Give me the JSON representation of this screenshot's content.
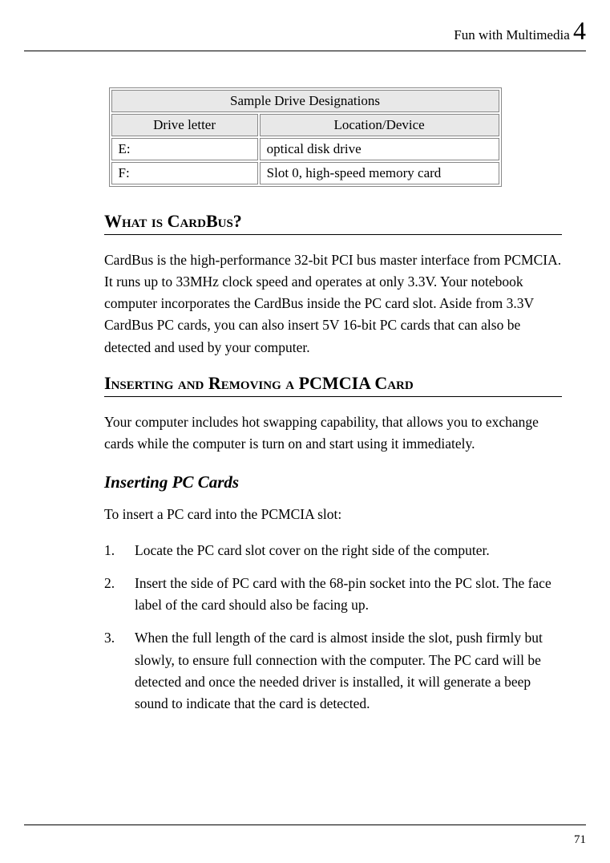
{
  "header": {
    "title": "Fun with Multimedia",
    "chapter": "4"
  },
  "table": {
    "title": "Sample Drive Designations",
    "col1_header": "Drive letter",
    "col2_header": "Location/Device",
    "rows": [
      {
        "letter": "E:",
        "device": "optical disk drive"
      },
      {
        "letter": "F:",
        "device": "Slot 0, high-speed memory card"
      }
    ]
  },
  "section1": {
    "heading": "What is CardBus?",
    "body": "CardBus is the high-performance 32-bit PCI bus master interface from PCMCIA. It runs up to 33MHz clock speed and operates at only 3.3V. Your notebook computer incorporates the CardBus inside the PC card slot. Aside from 3.3V CardBus PC cards, you can also insert 5V 16-bit PC cards that can also be detected and used by your computer."
  },
  "section2": {
    "heading": "Inserting and Removing a PCMCIA Card",
    "body": "Your computer includes hot swapping capability, that allows you to exchange cards while the computer is turn on and start using it immediately."
  },
  "section3": {
    "heading": "Inserting PC Cards",
    "intro": "To insert a PC card into the PCMCIA slot:",
    "steps": [
      "Locate the PC card slot cover on the right side of the computer.",
      "Insert the side of PC card with the 68-pin socket into the PC slot. The face label of the card should also be facing up.",
      "When the full length of the card is almost inside the slot, push firmly but slowly, to ensure full connection with the computer. The PC card will be detected and once the needed driver is installed, it will generate a beep sound to indicate that the card is detected."
    ]
  },
  "footer": {
    "page": "71"
  }
}
